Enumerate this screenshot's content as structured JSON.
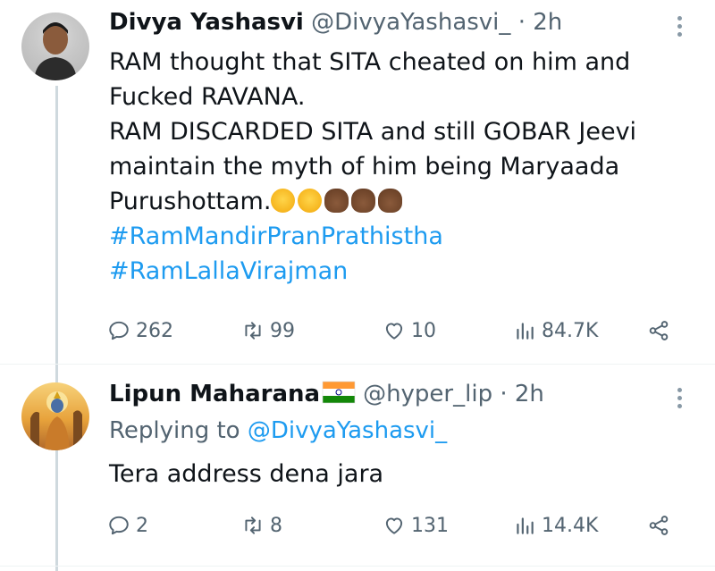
{
  "tweets": [
    {
      "author_name": "Divya Yashasvi",
      "handle": "@DivyaYashasvi_",
      "separator": "·",
      "time": "2h",
      "text_lines": [
        "RAM thought that SITA cheated on him and",
        "Fucked RAVANA.",
        "RAM DISCARDED SITA and still GOBAR Jeevi",
        "maintain the myth of him being Maryaada",
        "Purushottam."
      ],
      "emojis": [
        "rolling-on-floor-laughing",
        "rolling-on-floor-laughing",
        "pile-of-poo",
        "pile-of-poo",
        "pile-of-poo"
      ],
      "hashtags": [
        "#RamMandirPranPrathistha",
        "#RamLallaVirajman"
      ],
      "stats": {
        "replies": "262",
        "retweets": "99",
        "likes": "10",
        "views": "84.7K"
      }
    },
    {
      "author_name": "Lipun Maharana",
      "author_flag": "india-flag",
      "handle": "@hyper_lip",
      "separator": "·",
      "time": "2h",
      "replying_prefix": "Replying to",
      "replying_to": "@DivyaYashasvi_",
      "text": "Tera address dena jara",
      "stats": {
        "replies": "2",
        "retweets": "8",
        "likes": "131",
        "views": "14.4K"
      }
    }
  ],
  "colors": {
    "text": "#0f1419",
    "secondary": "#536471",
    "link": "#1d9bf0",
    "thread_line": "#cfd9de"
  },
  "icons": [
    "reply-icon",
    "retweet-icon",
    "like-icon",
    "views-icon",
    "share-icon",
    "more-icon"
  ]
}
